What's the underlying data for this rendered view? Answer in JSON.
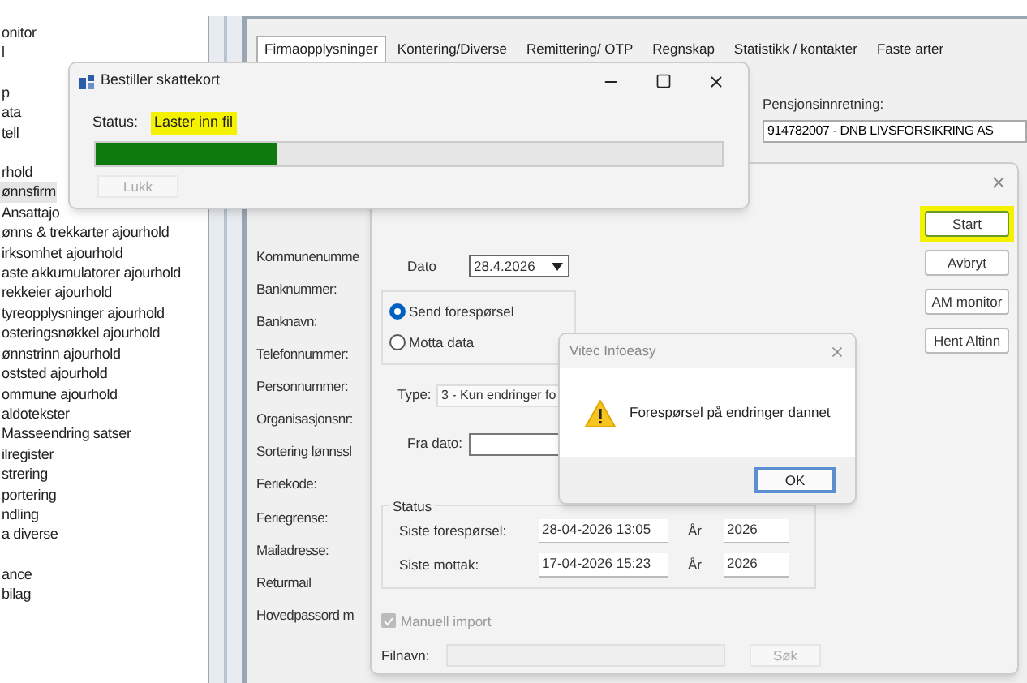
{
  "sidebar": {
    "groups": [
      {
        "items": [
          {
            "label": "onitor",
            "selected": false
          },
          {
            "label": "l",
            "selected": false
          }
        ]
      },
      {
        "items": [
          {
            "label": "p",
            "selected": false
          },
          {
            "label": "ata",
            "selected": false
          },
          {
            "label": "tell",
            "selected": false
          }
        ]
      },
      {
        "items": [
          {
            "label": "rhold",
            "selected": false
          },
          {
            "label": "ønnsfirm",
            "selected": true
          },
          {
            "label": "Ansattajo",
            "selected": false
          },
          {
            "label": "ønns & trekkarter ajourhold",
            "selected": false
          },
          {
            "label": "irksomhet ajourhold",
            "selected": false
          },
          {
            "label": "aste akkumulatorer ajourhold",
            "selected": false
          },
          {
            "label": "rekkeier ajourhold",
            "selected": false
          },
          {
            "label": "tyreopplysninger ajourhold",
            "selected": false
          },
          {
            "label": "osteringsnøkkel ajourhold",
            "selected": false
          },
          {
            "label": "ønnstrinn ajourhold",
            "selected": false
          },
          {
            "label": "oststed ajourhold",
            "selected": false
          },
          {
            "label": "ommune ajourhold",
            "selected": false
          },
          {
            "label": "aldotekster",
            "selected": false
          },
          {
            "label": "Masseendring satser",
            "selected": false
          },
          {
            "label": "ilregister",
            "selected": false
          },
          {
            "label": "strering",
            "selected": false
          },
          {
            "label": "portering",
            "selected": false
          },
          {
            "label": "ndling",
            "selected": false
          },
          {
            "label": "a diverse",
            "selected": false
          }
        ]
      },
      {
        "items": [
          {
            "label": "ance",
            "selected": false
          },
          {
            "label": "bilag",
            "selected": false
          }
        ]
      }
    ]
  },
  "main_window": {
    "tabs": [
      {
        "label": "Firmaopplysninger",
        "selected": true
      },
      {
        "label": "Kontering/Diverse",
        "selected": false
      },
      {
        "label": "Remittering/ OTP",
        "selected": false
      },
      {
        "label": "Regnskap",
        "selected": false
      },
      {
        "label": "Statistikk / kontakter",
        "selected": false
      },
      {
        "label": "Faste arter",
        "selected": false
      }
    ],
    "pension": {
      "label": "Pensjonsinnretning:",
      "value": "914782007 - DNB LIVSFORSIKRING AS"
    },
    "field_labels": [
      "Kommunenumme",
      "Banknummer:",
      "Banknavn:",
      "Telefonnummer:",
      "Personnummer:",
      "Organisasjonsnr:",
      "Sortering lønnssl",
      "Feriekode:",
      "Feriegrense:",
      "Mailadresse:",
      "Returmail",
      "Hovedpassord m"
    ]
  },
  "am_dialog": {
    "date": {
      "label": "Dato",
      "value": "28.4.2026"
    },
    "mode_options": [
      {
        "label": "Send forespørsel",
        "selected": true
      },
      {
        "label": "Motta data",
        "selected": false
      }
    ],
    "type": {
      "label": "Type:",
      "value": "3 - Kun endringer fo"
    },
    "from_date": {
      "label": "Fra dato:"
    },
    "status": {
      "title": "Status",
      "rows": [
        {
          "label": "Siste forespørsel:",
          "value": "28-04-2026 13:05",
          "year_label": "År",
          "year": "2026"
        },
        {
          "label": "Siste mottak:",
          "value": "17-04-2026 15:23",
          "year_label": "År",
          "year": "2026"
        }
      ]
    },
    "manual_import": {
      "label": "Manuell import",
      "checked": true,
      "disabled": true
    },
    "file": {
      "label": "Filnavn:"
    },
    "search_button": {
      "label": "Søk",
      "disabled": true
    },
    "buttons": [
      {
        "label": "Start",
        "highlighted": true
      },
      {
        "label": "Avbryt",
        "highlighted": false
      },
      {
        "label": "AM monitor",
        "highlighted": false
      },
      {
        "label": "Hent Altinn",
        "highlighted": false
      }
    ]
  },
  "progress_window": {
    "title": "Bestiller skattekort",
    "status_label": "Status:",
    "status_value": "Laster inn fil",
    "status_highlighted": true,
    "level": 0.29,
    "close_button": {
      "label": "Lukk",
      "disabled": true
    }
  },
  "message_box": {
    "title": "Vitec Infoeasy",
    "message": "Forespørsel på endringer dannet",
    "ok_button": "OK"
  }
}
